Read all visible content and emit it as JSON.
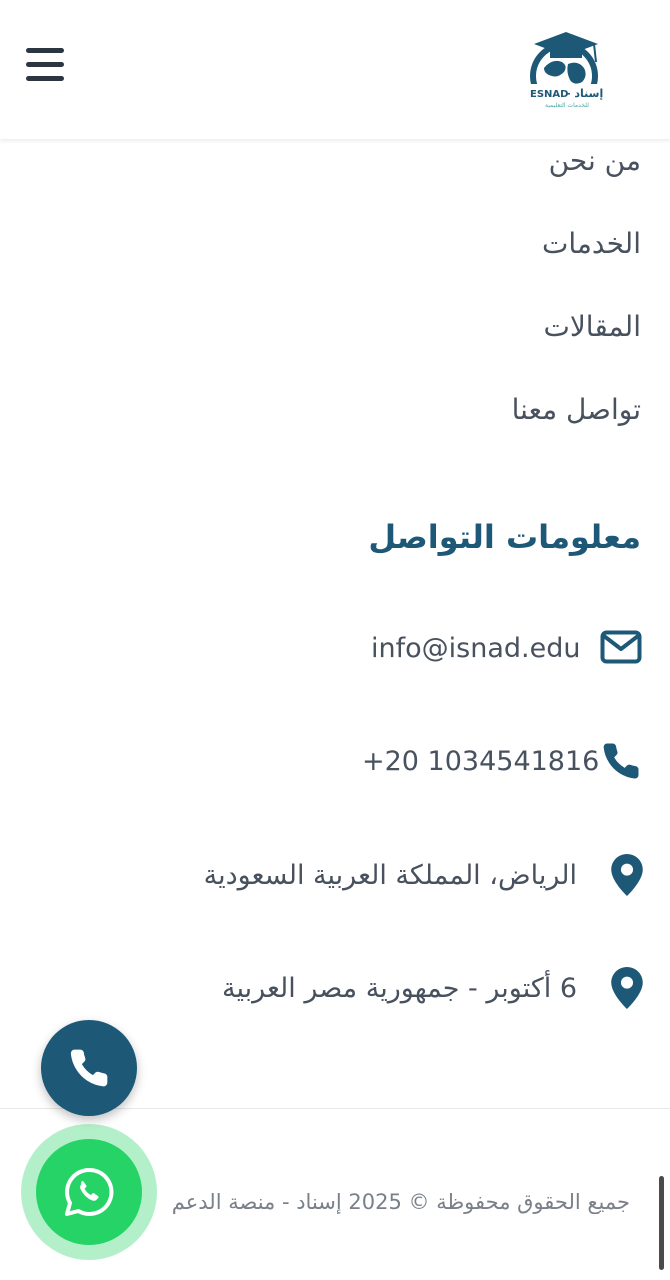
{
  "header": {
    "logo_en": "ESNAD",
    "logo_ar": "إسناد -",
    "logo_sub": "للخدمات التعليمية"
  },
  "nav": {
    "items": [
      {
        "label": "من نحن"
      },
      {
        "label": "الخدمات"
      },
      {
        "label": "المقالات"
      },
      {
        "label": "تواصل معنا"
      }
    ]
  },
  "contact": {
    "title": "معلومات التواصل",
    "email": "info@isnad.edu",
    "phone": "+20 1034541816",
    "address_1": "الرياض، المملكة العربية السعودية",
    "address_2": "6 أكتوبر - جمهورية مصر العربية"
  },
  "footer": {
    "copyright": "جميع الحقوق محفوظة © 2025 إسناد - منصة الدعم"
  },
  "colors": {
    "brand": "#1d5877",
    "text": "#48515e",
    "whatsapp": "#25d366"
  },
  "icons": {
    "menu": "hamburger-icon",
    "email": "envelope-icon",
    "phone": "phone-icon",
    "location": "map-pin-icon",
    "whatsapp": "whatsapp-icon"
  }
}
